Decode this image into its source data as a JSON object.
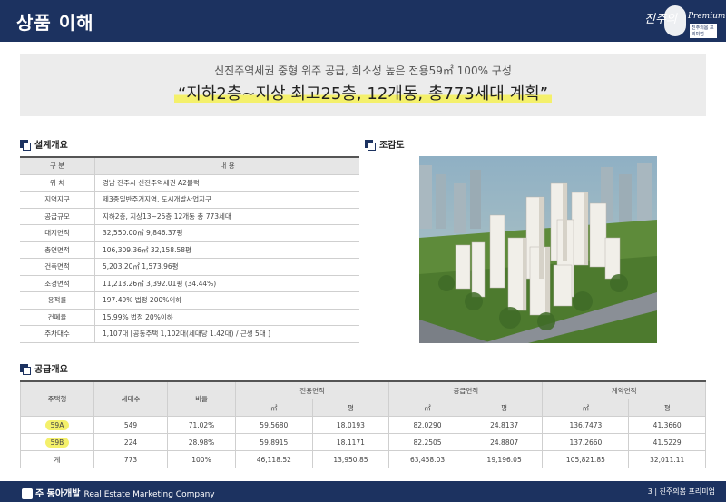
{
  "header": {
    "title": "상품 이해",
    "logo": {
      "script": "진주의",
      "premium": "Premium",
      "tag": "진주의봄 프리미엄"
    }
  },
  "banner": {
    "subtitle": "신진주역세권 중형 위주 공급, 희소성 높은 전용59㎡ 100% 구성",
    "headline": "“지하2층~지상 최고25층, 12개동, 총773세대 계획”"
  },
  "design": {
    "title": "설계개요",
    "header": [
      "구 분",
      "내 용"
    ],
    "rows": [
      {
        "k": "위 치",
        "v": "경남 진주시 신진주역세권 A2블럭"
      },
      {
        "k": "지역지구",
        "v": "제3종일반주거지역, 도시개발사업지구"
      },
      {
        "k": "공급규모",
        "v": "지하2층, 지상13~25층 12개동 총 773세대"
      },
      {
        "k": "대지면적",
        "v": "32,550.00㎡   9,846.37평"
      },
      {
        "k": "총연면적",
        "v": "106,309.36㎡   32,158.58평"
      },
      {
        "k": "건축면적",
        "v": "5,203.20㎡   1,573.96평"
      },
      {
        "k": "조경면적",
        "v": "11,213.26㎡   3,392.01평 (34.44%)"
      },
      {
        "k": "용적률",
        "v": "197.49%   법정 200%이하"
      },
      {
        "k": "건폐율",
        "v": "15.99%   법정 20%이하"
      },
      {
        "k": "주차대수",
        "v": "1,107대 [공동주택 1,102대(세대당 1.42대) / 근생 5대 ]"
      }
    ]
  },
  "birdseye": {
    "title": "조감도"
  },
  "supply": {
    "title": "공급개요",
    "headers": {
      "type": "주택형",
      "units": "세대수",
      "ratio": "비율",
      "groups": [
        "전용면적",
        "공급면적",
        "계약면적"
      ],
      "sub": [
        "㎡",
        "평",
        "㎡",
        "평",
        "㎡",
        "평"
      ]
    },
    "rows": [
      {
        "type": "59A",
        "units": "549",
        "ratio": "71.02%",
        "vals": [
          "59.5680",
          "18.0193",
          "82.0290",
          "24.8137",
          "136.7473",
          "41.3660"
        ]
      },
      {
        "type": "59B",
        "units": "224",
        "ratio": "28.98%",
        "vals": [
          "59.8915",
          "18.1171",
          "82.2505",
          "24.8807",
          "137.2660",
          "41.5229"
        ]
      },
      {
        "type": "계",
        "units": "773",
        "ratio": "100%",
        "vals": [
          "46,118.52",
          "13,950.85",
          "63,458.03",
          "19,196.05",
          "105,821.85",
          "32,011.11"
        ]
      }
    ]
  },
  "footer": {
    "brand": "주 동아개발",
    "tagline": "Real Estate Marketing Company",
    "page": "3 | 진주의봄 프리미엄"
  },
  "colors": {
    "navy": "#1c3260",
    "highlight": "#f4f06b",
    "banner_bg": "#ececec"
  }
}
